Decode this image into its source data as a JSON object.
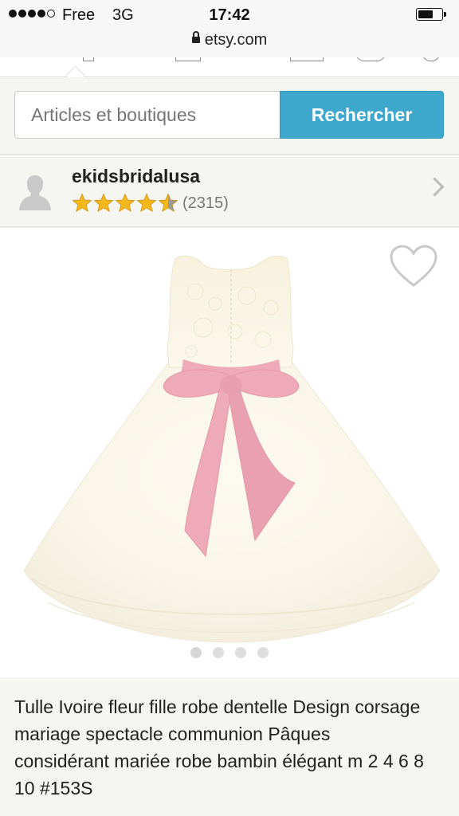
{
  "status_bar": {
    "carrier": "Free",
    "network": "3G",
    "time": "17:42",
    "signal_bars_filled": 4,
    "signal_bars_total": 5,
    "battery_level": 0.66
  },
  "browser": {
    "url": "etsy.com"
  },
  "search": {
    "placeholder": "Articles et boutiques",
    "button_label": "Rechercher",
    "button_color": "#3ea7cc"
  },
  "shop": {
    "name": "ekidsbridalusa",
    "rating": 4.5,
    "rating_max": 5,
    "review_count": "(2315)",
    "star_color": "#f5b81c"
  },
  "listing": {
    "image_count": 4,
    "active_image_index": 0,
    "title": "Tulle Ivoire fleur fille robe dentelle Design corsage mariage spectacle communion Pâques considérant mariée robe bambin élégant m 2 4 6 8 10 #153S",
    "sash_color": "#eeaab8",
    "dress_color": "#fbf8ec"
  }
}
